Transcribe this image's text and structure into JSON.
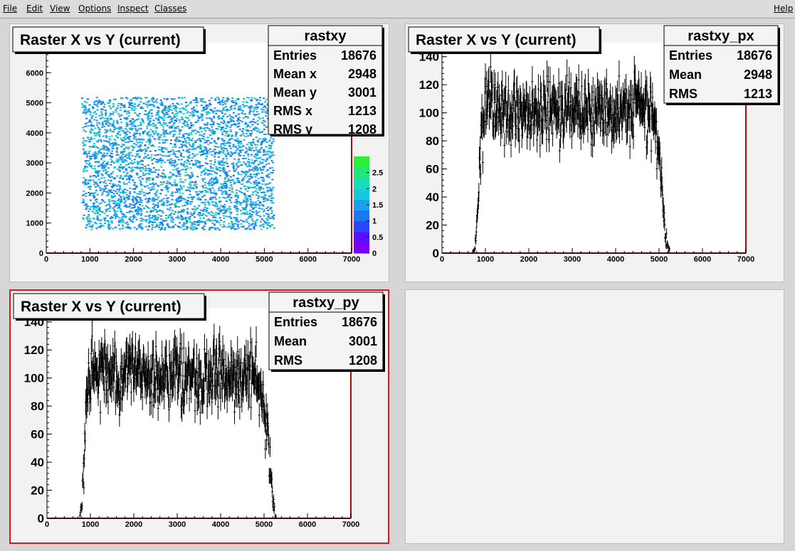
{
  "menu": {
    "items": [
      "File",
      "Edit",
      "View",
      "Options",
      "Inspect",
      "Classes"
    ],
    "help": "Help"
  },
  "colors": {
    "pad_bg": "#f2f2f2",
    "frame": "#a01010",
    "selected_border": "#e01818",
    "marker": "#000000",
    "palette": [
      "#7a00ff",
      "#5a10ff",
      "#2848ff",
      "#1a78f0",
      "#1ca0ea",
      "#18c8e0",
      "#16dfb8",
      "#20e878",
      "#2bf038"
    ]
  },
  "pads": [
    {
      "title": "Raster X vs Y (current)",
      "stats": {
        "name": "rastxy",
        "rows": [
          {
            "label": "Entries",
            "value": "18676"
          },
          {
            "label": "Mean x",
            "value": "2948"
          },
          {
            "label": "Mean y",
            "value": "3001"
          },
          {
            "label": "RMS x",
            "value": "1213"
          },
          {
            "label": "RMS y",
            "value": "1208"
          }
        ]
      }
    },
    {
      "title": "Raster X vs Y (current)",
      "stats": {
        "name": "rastxy_px",
        "rows": [
          {
            "label": "Entries",
            "value": "18676"
          },
          {
            "label": "Mean",
            "value": "2948"
          },
          {
            "label": "RMS",
            "value": "1213"
          }
        ]
      }
    },
    {
      "title": "Raster X vs Y (current)",
      "stats": {
        "name": "rastxy_py",
        "rows": [
          {
            "label": "Entries",
            "value": "18676"
          },
          {
            "label": "Mean",
            "value": "3001"
          },
          {
            "label": "RMS",
            "value": "1208"
          }
        ]
      }
    }
  ],
  "chart_data": [
    {
      "type": "heatmap",
      "title": "Raster X vs Y (current)",
      "xlim": [
        0,
        7000
      ],
      "ylim": [
        0,
        7000
      ],
      "x_ticks": [
        "0",
        "1000",
        "2000",
        "3000",
        "4000",
        "5000",
        "6000",
        "7000"
      ],
      "y_ticks": [
        "0",
        "1000",
        "2000",
        "3000",
        "4000",
        "5000",
        "6000"
      ],
      "z_ticks": [
        "0",
        "0.5",
        "1",
        "1.5",
        "2",
        "2.5"
      ],
      "zlim": [
        0,
        3
      ],
      "populated_region": {
        "x": [
          800,
          5200
        ],
        "y": [
          800,
          5200
        ]
      },
      "entries": 18676
    },
    {
      "type": "scatter",
      "title": "Raster X vs Y (current)",
      "xlim": [
        0,
        7000
      ],
      "ylim": [
        0,
        150
      ],
      "x_ticks": [
        "0",
        "1000",
        "2000",
        "3000",
        "4000",
        "5000",
        "6000",
        "7000"
      ],
      "y_ticks": [
        "0",
        "20",
        "40",
        "60",
        "80",
        "100",
        "120",
        "140"
      ],
      "error_bars": true,
      "x": [
        700,
        750,
        800,
        850,
        900,
        950,
        1000,
        1200,
        1500,
        2000,
        2500,
        3000,
        3500,
        4000,
        4500,
        4800,
        4900,
        4950,
        5000,
        5050,
        5100,
        5150,
        5200,
        5250
      ],
      "values": [
        0,
        2,
        15,
        50,
        80,
        95,
        105,
        108,
        100,
        100,
        102,
        99,
        103,
        100,
        104,
        100,
        95,
        88,
        70,
        50,
        30,
        10,
        3,
        0
      ]
    },
    {
      "type": "scatter",
      "title": "Raster X vs Y (current)",
      "xlim": [
        0,
        7000
      ],
      "ylim": [
        0,
        150
      ],
      "x_ticks": [
        "0",
        "1000",
        "2000",
        "3000",
        "4000",
        "5000",
        "6000",
        "7000"
      ],
      "y_ticks": [
        "0",
        "20",
        "40",
        "60",
        "80",
        "100",
        "120",
        "140"
      ],
      "error_bars": true,
      "x": [
        750,
        800,
        850,
        900,
        950,
        1000,
        1200,
        1500,
        2000,
        2500,
        3000,
        3500,
        4000,
        4500,
        4800,
        4900,
        5000,
        5100,
        5150,
        5200,
        5250
      ],
      "values": [
        0,
        10,
        35,
        75,
        90,
        100,
        105,
        100,
        103,
        99,
        104,
        100,
        102,
        103,
        100,
        95,
        80,
        60,
        35,
        12,
        2
      ]
    }
  ]
}
